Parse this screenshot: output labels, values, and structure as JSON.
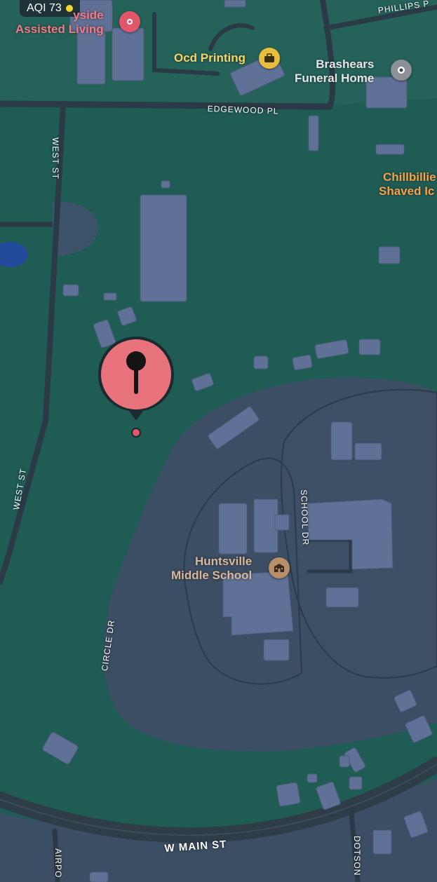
{
  "aqi": {
    "label": "AQI 73",
    "level_color": "#f2d82b"
  },
  "pois": [
    {
      "id": "assisted-living",
      "name_line1": "yside",
      "name_line2": "Assisted Living",
      "icon": "pin-icon",
      "color": "#f07a86"
    },
    {
      "id": "ocd-printing",
      "name": "Ocd Printing",
      "icon": "briefcase-icon",
      "color": "#f5d56a"
    },
    {
      "id": "brashears",
      "name_line1": "Brashears",
      "name_line2": "Funeral Home",
      "icon": "dot-icon",
      "color": "#e6e6e6"
    },
    {
      "id": "chillbillies",
      "name_line1": "Chillbillie",
      "name_line2": "Shaved Ic",
      "color": "#f5a04a"
    },
    {
      "id": "school",
      "name_line1": "Huntsville",
      "name_line2": "Middle School",
      "icon": "school-icon",
      "color": "#d9b79a"
    }
  ],
  "streets": {
    "phillips": "PHILLIPS P",
    "edgewood": "EDGEWOOD PL",
    "west_top": "WEST ST",
    "west_mid": "WEST ST",
    "school_dr": "SCHOOL DR",
    "circle_dr": "CIRCLE DR",
    "w_main": "W MAIN ST",
    "airport": "AIRPO",
    "dotson": "DOTSON"
  },
  "dropped_pin": {
    "color": "#e8737d"
  }
}
